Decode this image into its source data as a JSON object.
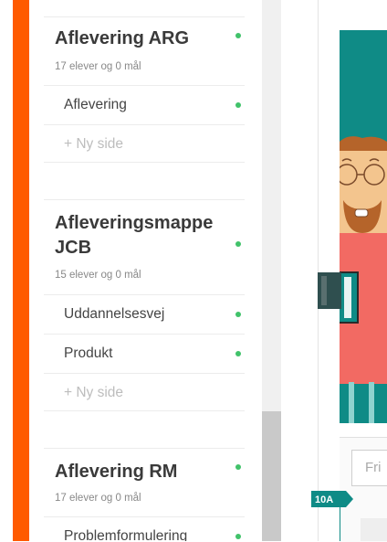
{
  "colors": {
    "accent": "#ff5a00",
    "teal": "#0f8b86",
    "status_green": "#41c26a"
  },
  "groups": [
    {
      "title": "Aflevering ARG",
      "subtitle": "17 elever og 0 mål",
      "pages": [
        "Aflevering"
      ],
      "new_page": "+ Ny side"
    },
    {
      "title": "Afleveringsmappe JCB",
      "subtitle": "15 elever og 0 mål",
      "pages": [
        "Uddannelsesvej",
        "Produkt"
      ],
      "new_page": "+ Ny side"
    },
    {
      "title": "Aflevering RM",
      "subtitle": "17 elever og 0 mål",
      "pages": [
        "Problemformulering"
      ]
    }
  ],
  "preview": {
    "input_placeholder": "Fri",
    "class_tag": "10A"
  }
}
